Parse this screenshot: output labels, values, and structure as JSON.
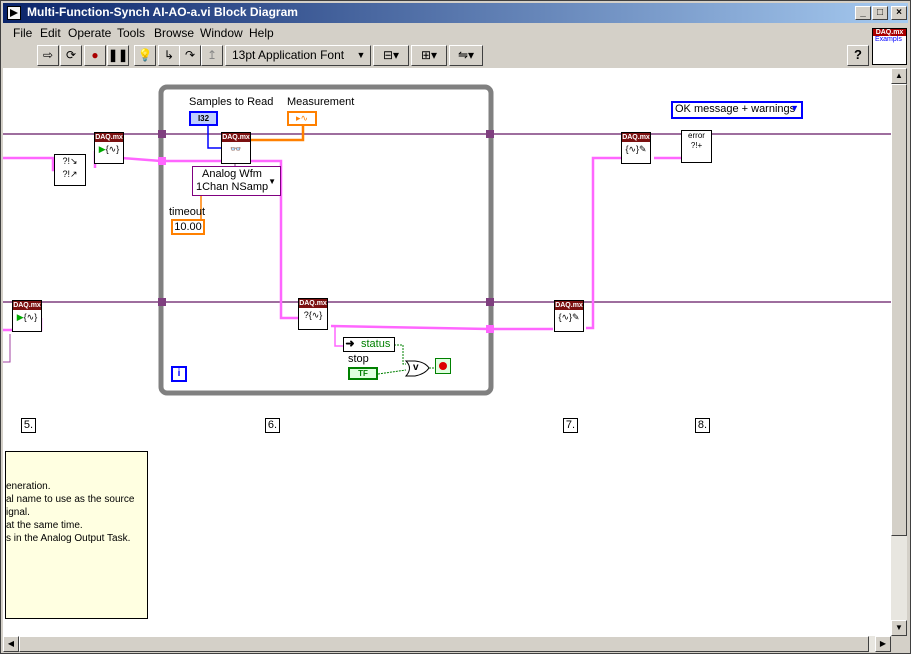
{
  "window": {
    "title": "Multi-Function-Synch AI-AO-a.vi Block Diagram",
    "controls": {
      "minimize": "_",
      "maximize": "□",
      "close": "×"
    }
  },
  "menu": [
    "File",
    "Edit",
    "Operate",
    "Tools",
    "Browse",
    "Window",
    "Help"
  ],
  "toolbar": {
    "buttons": [
      "run-arrow",
      "run-continuously",
      "abort",
      "pause",
      "highlight-execution",
      "step-into",
      "step-over",
      "step-out"
    ],
    "font": "13pt Application Font",
    "help": "?"
  },
  "vi_icon": {
    "header": "DAQ.mx",
    "text": "Exampls"
  },
  "diagram": {
    "daq_header": "DAQ.mx",
    "samples_to_read": "Samples to Read",
    "samples_type": "I32",
    "measurement": "Measurement",
    "analog_wfm_line1": "Analog Wfm",
    "analog_wfm_line2": "1Chan NSamp",
    "timeout_label": "timeout",
    "timeout_value": "10.00",
    "status": "status",
    "stop": "stop",
    "tf": "TF",
    "loop_index": "i",
    "error_handler": "OK message + warnings",
    "frames": [
      "5.",
      "6.",
      "7.",
      "8."
    ]
  },
  "comment_lines": [
    "eneration.",
    "al name to use as the source",
    "",
    "ignal.",
    "",
    "at the same time.",
    "s in the Analog Output Task."
  ],
  "colors": {
    "wire_daq": "#7f3f7f",
    "wire_error": "#ff66ff",
    "loop_border": "#808080",
    "dbl_orange": "#ff8000",
    "int_blue": "#0000ff",
    "bool_green": "#008000"
  }
}
